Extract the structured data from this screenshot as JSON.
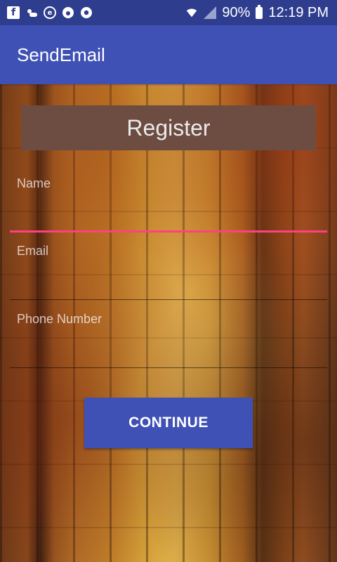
{
  "status_bar": {
    "left_icons": [
      "facebook-icon",
      "weather-icon",
      "e-app-icon",
      "cloud-app-icon",
      "chrome-icon"
    ],
    "battery": "90%",
    "time": "12:19 PM"
  },
  "app_bar": {
    "title": "SendEmail"
  },
  "form": {
    "banner": "Register",
    "name": {
      "placeholder": "Name",
      "value": ""
    },
    "email": {
      "placeholder": "Email",
      "value": ""
    },
    "phone": {
      "placeholder": "Phone Number",
      "value": ""
    },
    "continue_label": "CONTINUE"
  },
  "colors": {
    "primary": "#3f51b5",
    "primary_dark": "#2f3d8f",
    "accent": "#ff4081",
    "banner": "#6d4c41"
  }
}
